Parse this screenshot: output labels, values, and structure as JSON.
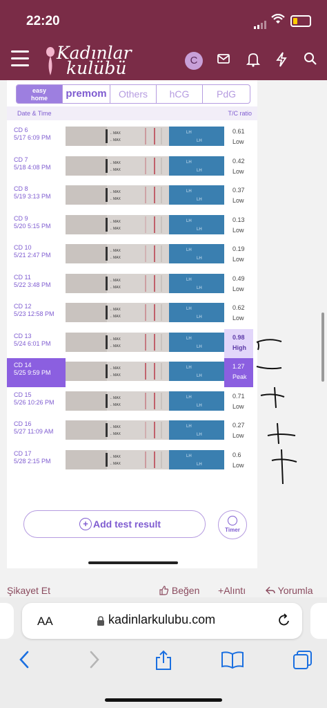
{
  "status_bar": {
    "time": "22:20"
  },
  "header": {
    "logo_line1": "Kadınlar",
    "logo_line2": "kulübü",
    "avatar_letter": "C"
  },
  "tabs": [
    {
      "label_top": "easy",
      "label_bottom": "home"
    },
    {
      "label": "premom"
    },
    {
      "label": "Others"
    },
    {
      "label": "hCG"
    },
    {
      "label": "PdG"
    }
  ],
  "list_header": {
    "left": "Date & Time",
    "right": "T/C ratio"
  },
  "rows": [
    {
      "cd": "CD 6",
      "date": "5/17 6:09 PM",
      "ratio": "0.61",
      "level": "Low",
      "line_intensity": 0.4
    },
    {
      "cd": "CD 7",
      "date": "5/18 4:08 PM",
      "ratio": "0.42",
      "level": "Low",
      "line_intensity": 0.3
    },
    {
      "cd": "CD 8",
      "date": "5/19 3:13 PM",
      "ratio": "0.37",
      "level": "Low",
      "line_intensity": 0.3
    },
    {
      "cd": "CD 9",
      "date": "5/20 5:15 PM",
      "ratio": "0.13",
      "level": "Low",
      "line_intensity": 0.1
    },
    {
      "cd": "CD 10",
      "date": "5/21 2:47 PM",
      "ratio": "0.19",
      "level": "Low",
      "line_intensity": 0.15
    },
    {
      "cd": "CD 11",
      "date": "5/22 3:48 PM",
      "ratio": "0.49",
      "level": "Low",
      "line_intensity": 0.35
    },
    {
      "cd": "CD 12",
      "date": "5/23 12:58 PM",
      "ratio": "0.62",
      "level": "Low",
      "line_intensity": 0.45
    },
    {
      "cd": "CD 13",
      "date": "5/24 6:01 PM",
      "ratio": "0.98",
      "level": "High",
      "line_intensity": 0.75
    },
    {
      "cd": "CD 14",
      "date": "5/25 9:59 PM",
      "ratio": "1.27",
      "level": "Peak",
      "line_intensity": 0.95
    },
    {
      "cd": "CD 15",
      "date": "5/26 10:26 PM",
      "ratio": "0.71",
      "level": "Low",
      "line_intensity": 0.5
    },
    {
      "cd": "CD 16",
      "date": "5/27 11:09 AM",
      "ratio": "0.27",
      "level": "Low",
      "line_intensity": 0.2
    },
    {
      "cd": "CD 17",
      "date": "5/28 2:15 PM",
      "ratio": "0.6",
      "level": "Low",
      "line_intensity": 0.4
    }
  ],
  "strip_text": {
    "max": "MAX",
    "lh": "LH"
  },
  "buttons": {
    "add_result": "Add test result",
    "timer": "Timer"
  },
  "footer": {
    "complaint": "Şikayet Et",
    "like": "Beğen",
    "quote": "Alıntı",
    "comment": "Yorumla"
  },
  "browser": {
    "aa": "AA",
    "url": "kadinlarkulubu.com"
  },
  "colors": {
    "brand": "#7a2c47",
    "accent": "#8b5fe0",
    "strip_blue": "#3a7fb0",
    "test_line": "#c0606a"
  }
}
